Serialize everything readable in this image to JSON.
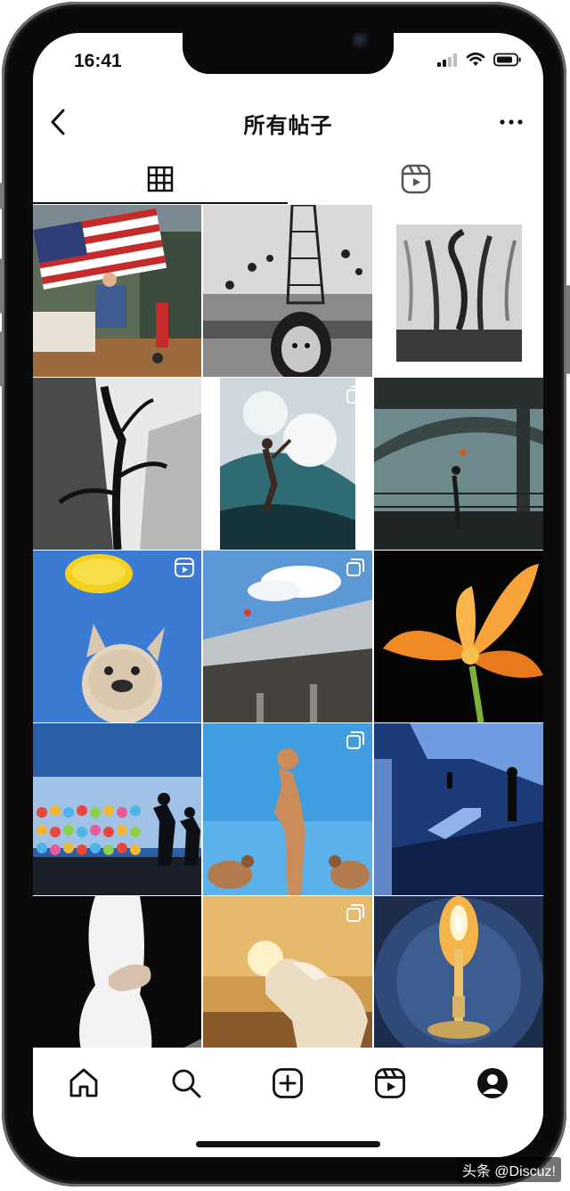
{
  "status_bar": {
    "time": "16:41"
  },
  "header": {
    "title": "所有帖子"
  },
  "tabs": [
    {
      "icon": "grid-icon",
      "active": true
    },
    {
      "icon": "reels-icon",
      "active": false
    }
  ],
  "posts": [
    {
      "subject": "american-flag-porch",
      "badge": "none"
    },
    {
      "subject": "swing-ride-child",
      "badge": "none"
    },
    {
      "subject": "foggy-trees",
      "badge": "none"
    },
    {
      "subject": "tree-skyscrapers",
      "badge": "none"
    },
    {
      "subject": "surfer-wave",
      "badge": "multiple"
    },
    {
      "subject": "bridge-basketball",
      "badge": "none"
    },
    {
      "subject": "frisbee-bulldog",
      "badge": "reel"
    },
    {
      "subject": "balloon-rooftop",
      "badge": "multiple"
    },
    {
      "subject": "orange-lily",
      "badge": "none"
    },
    {
      "subject": "lanterns-silhouettes",
      "badge": "none"
    },
    {
      "subject": "statue-sky",
      "badge": "multiple"
    },
    {
      "subject": "stairs-shadow",
      "badge": "none"
    },
    {
      "subject": "hand-shadow",
      "badge": "none"
    },
    {
      "subject": "white-horse-sunset",
      "badge": "multiple"
    },
    {
      "subject": "candle-book",
      "badge": "none"
    }
  ],
  "bottom_nav": [
    "home-icon",
    "search-icon",
    "create-icon",
    "reels-nav-icon",
    "profile-icon"
  ],
  "watermark": "头条 @Discuz!"
}
